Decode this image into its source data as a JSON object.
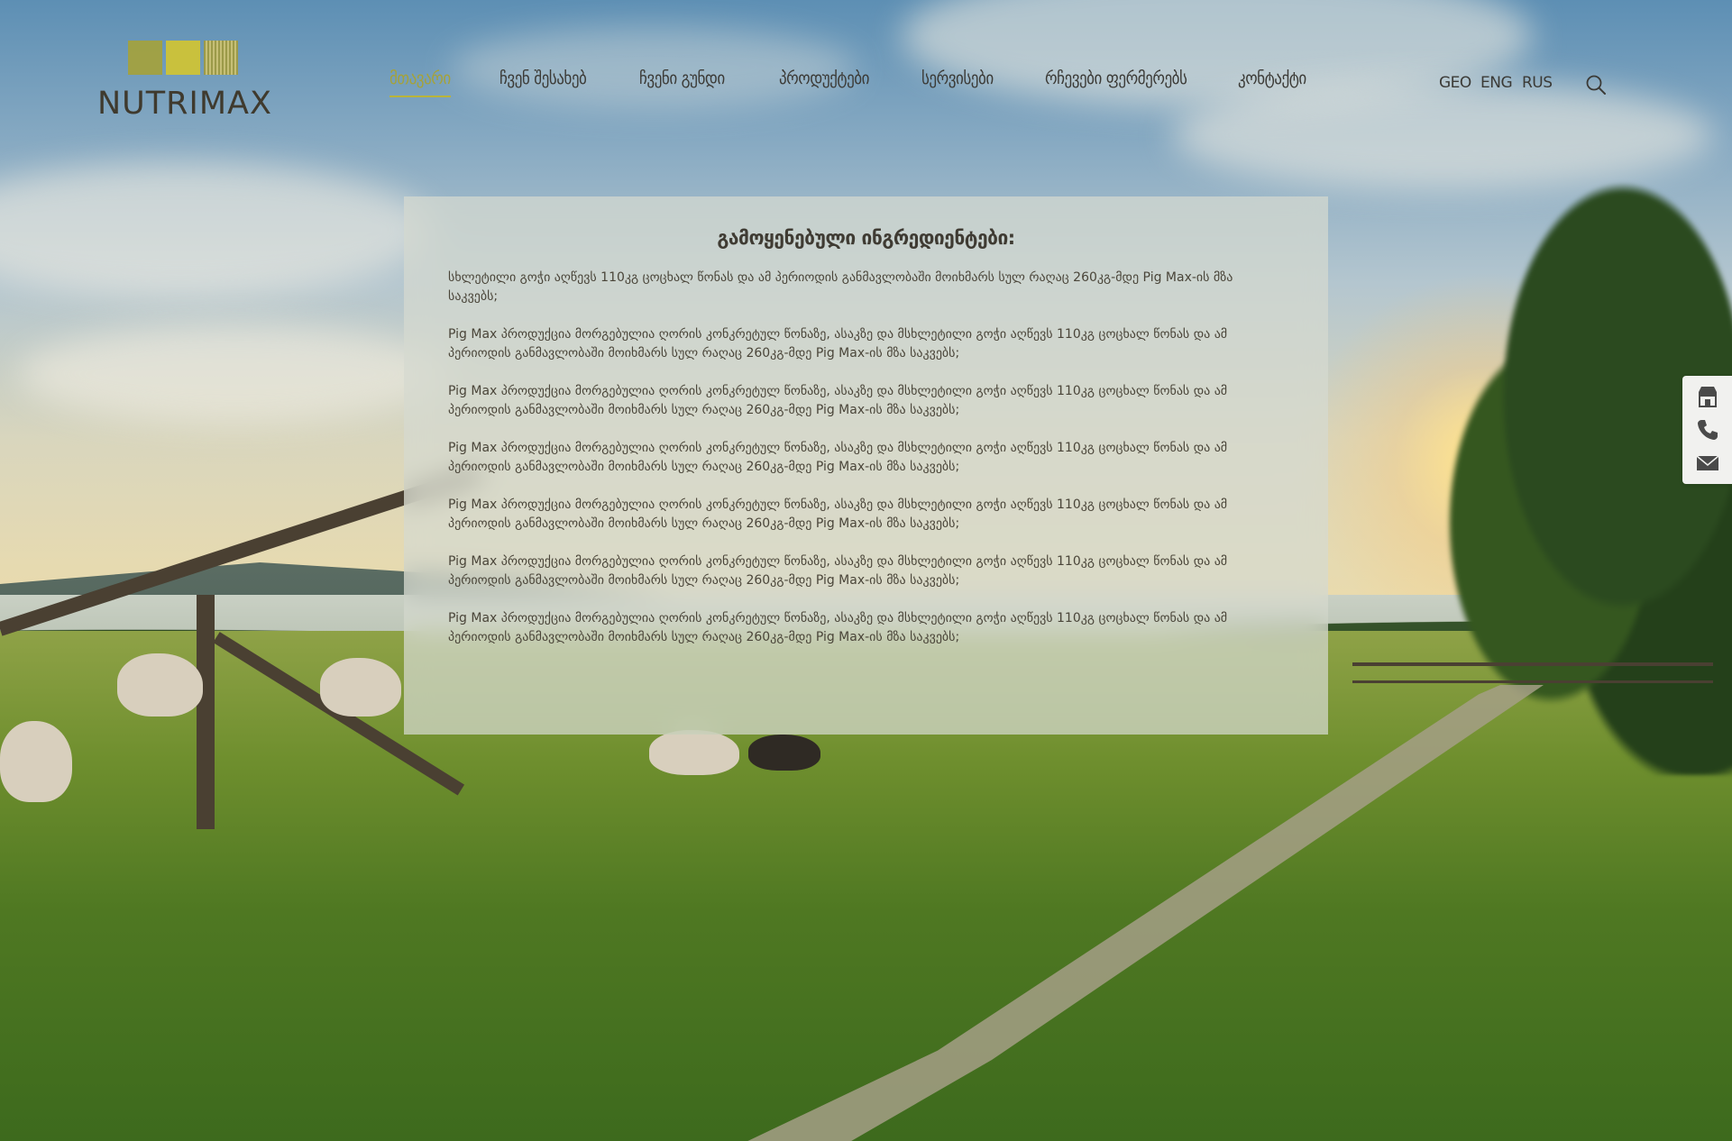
{
  "brand": {
    "name": "NUTRIMAX"
  },
  "nav": {
    "items": [
      {
        "label": "მთავარი",
        "active": true
      },
      {
        "label": "ჩვენ შესახებ",
        "active": false
      },
      {
        "label": "ჩვენი გუნდი",
        "active": false
      },
      {
        "label": "პროდუქტები",
        "active": false
      },
      {
        "label": "სერვისები",
        "active": false
      },
      {
        "label": "რჩევები ფერმერებს",
        "active": false
      },
      {
        "label": "კონტაქტი",
        "active": false
      }
    ]
  },
  "languages": [
    "GEO",
    "ENG",
    "RUS"
  ],
  "content": {
    "title": "გამოყენებული ინგრედიენტები:",
    "paragraphs": [
      "სხლეტილი გოჭი აღწევს 110კგ ცოცხალ წონას და ამ პერიოდის განმავლობაში მოიხმარს სულ რაღაც 260კგ-მდე Pig Max-ის მზა საკვებს;",
      "Pig Max პროდუქცია მორგებულია ღორის კონკრეტულ წონაზე, ასაკზე და მსხლეტილი გოჭი აღწევს 110კგ ცოცხალ წონას და ამ პერიოდის განმავლობაში მოიხმარს სულ რაღაც 260კგ-მდე Pig Max-ის მზა საკვებს;",
      "Pig Max პროდუქცია მორგებულია ღორის კონკრეტულ წონაზე, ასაკზე და მსხლეტილი გოჭი აღწევს 110კგ ცოცხალ წონას და ამ პერიოდის განმავლობაში მოიხმარს სულ რაღაც 260კგ-მდე Pig Max-ის მზა საკვებს;",
      "Pig Max პროდუქცია მორგებულია ღორის კონკრეტულ წონაზე, ასაკზე და მსხლეტილი გოჭი აღწევს 110კგ ცოცხალ წონას და ამ პერიოდის განმავლობაში მოიხმარს სულ რაღაც 260კგ-მდე Pig Max-ის მზა საკვებს;",
      "Pig Max პროდუქცია მორგებულია ღორის კონკრეტულ წონაზე, ასაკზე და მსხლეტილი გოჭი აღწევს 110კგ ცოცხალ წონას და ამ პერიოდის განმავლობაში მოიხმარს სულ რაღაც 260კგ-მდე Pig Max-ის მზა საკვებს;",
      "Pig Max პროდუქცია მორგებულია ღორის კონკრეტულ წონაზე, ასაკზე და მსხლეტილი გოჭი აღწევს 110კგ ცოცხალ წონას და ამ პერიოდის განმავლობაში მოიხმარს სულ რაღაც 260კგ-მდე Pig Max-ის მზა საკვებს;",
      "Pig Max პროდუქცია მორგებულია ღორის კონკრეტულ წონაზე, ასაკზე და მსხლეტილი გოჭი აღწევს 110კგ ცოცხალ წონას და ამ პერიოდის განმავლობაში მოიხმარს სულ რაღაც 260კგ-მდე Pig Max-ის მზა საკვებს;"
    ]
  },
  "side_contacts": {
    "icons": [
      "store-icon",
      "phone-icon",
      "mail-icon"
    ]
  },
  "icons": {
    "search": "search-icon"
  },
  "colors": {
    "accent": "#a5a23a",
    "nav_text": "#3b3a36",
    "card_bg": "#d6dad0"
  }
}
